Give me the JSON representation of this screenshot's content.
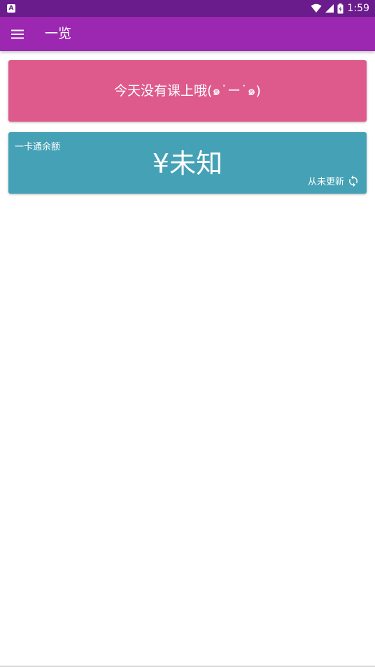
{
  "status_bar": {
    "notification_icon": "A",
    "time": "1:59",
    "icons": [
      "wifi-icon",
      "signal-icon",
      "battery-icon"
    ]
  },
  "app_bar": {
    "title": "一览",
    "menu_icon": "menu-icon"
  },
  "schedule_card": {
    "message": "今天没有课上哦(๑˙ー˙๑)",
    "color": "#de5a8c"
  },
  "balance_card": {
    "label": "一卡通余额",
    "value": "¥未知",
    "update_status": "从未更新",
    "refresh_icon": "refresh-icon",
    "color": "#45a1b5"
  },
  "colors": {
    "primary": "#9c27b0",
    "primary_dark": "#6a1b8c"
  }
}
